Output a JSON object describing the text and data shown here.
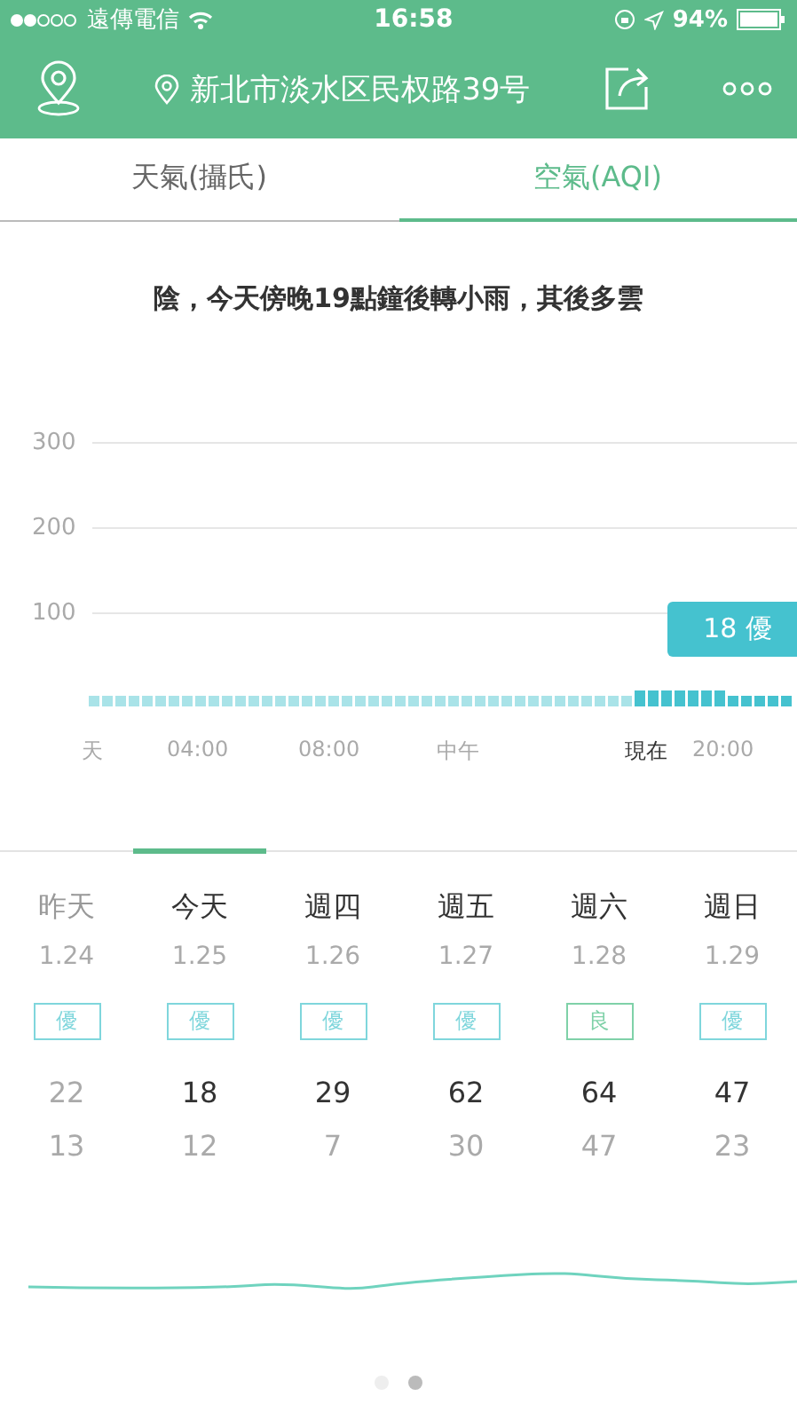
{
  "status_bar": {
    "carrier": "遠傳電信",
    "time": "16:58",
    "battery": "94%"
  },
  "header": {
    "location": "新北市淡水区民权路39号"
  },
  "tabs": [
    {
      "label": "天氣(攝氏)",
      "selected": false
    },
    {
      "label": "空氣(AQI)",
      "selected": true
    }
  ],
  "summary": "陰，今天傍晚19點鐘後轉小雨，其後多雲",
  "hourly": {
    "y_labels": [
      "300",
      "200",
      "100"
    ],
    "callout": "18 優",
    "time_labels": [
      {
        "label": "天",
        "current": false
      },
      {
        "label": "04:00",
        "current": false
      },
      {
        "label": "08:00",
        "current": false
      },
      {
        "label": "中午",
        "current": false
      },
      {
        "label": "現在",
        "current": true
      },
      {
        "label": "20:00",
        "current": false
      }
    ]
  },
  "days": [
    {
      "name": "昨天",
      "date": "1.24",
      "badge": "優",
      "color": "#7fd6dc",
      "high": "22",
      "low": "13",
      "past": true,
      "selected": false
    },
    {
      "name": "今天",
      "date": "1.25",
      "badge": "優",
      "color": "#7fd6dc",
      "high": "18",
      "low": "12",
      "past": false,
      "selected": true
    },
    {
      "name": "週四",
      "date": "1.26",
      "badge": "優",
      "color": "#7fd6dc",
      "high": "29",
      "low": "7",
      "past": false,
      "selected": false
    },
    {
      "name": "週五",
      "date": "1.27",
      "badge": "優",
      "color": "#7fd6dc",
      "high": "62",
      "low": "30",
      "past": false,
      "selected": false
    },
    {
      "name": "週六",
      "date": "1.28",
      "badge": "良",
      "color": "#7fd1a8",
      "high": "64",
      "low": "47",
      "past": false,
      "selected": false
    },
    {
      "name": "週日",
      "date": "1.29",
      "badge": "優",
      "color": "#7fd6dc",
      "high": "47",
      "low": "23",
      "past": false,
      "selected": false
    }
  ],
  "pages": [
    {
      "selected": false
    },
    {
      "selected": true
    }
  ]
}
